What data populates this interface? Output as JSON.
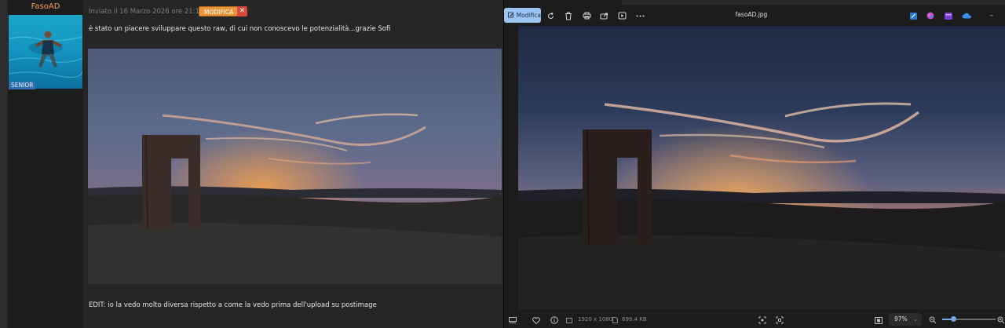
{
  "forum": {
    "username": "FasoAD",
    "rank": "SENIOR",
    "post_meta": "Inviato il 16 Marzo 2026 ore 21:10",
    "edit_label": "MODIFICA",
    "delete_label": "✕",
    "post_text": "è stato un piacere sviluppare questo raw, di cui non conoscevo le potenzialità...grazie Sofi",
    "edit_note": "EDIT: io la vedo molto diversa rispetto a come la vedo prima dell'upload su postimage"
  },
  "viewer": {
    "edit_button_label": "Modifica",
    "file_title": "fasoAD.jpg",
    "toolbar_icons": [
      "rotate-icon",
      "delete-icon",
      "print-icon",
      "share-icon",
      "slideshow-icon",
      "more-icon"
    ],
    "app_icons": [
      "app-blue-icon",
      "app-copilot-icon",
      "app-clipchamp-icon",
      "onedrive-icon"
    ],
    "resolution": "1920 x 1080",
    "file_size": "699.4 KB",
    "zoom_label": "97%",
    "zoom_fraction": 0.2,
    "minimize_label": "–"
  },
  "colors": {
    "accent": "#9cc5f5",
    "username": "#f0a24a",
    "edit_button": "#e8963a",
    "delete_button": "#d94a3d",
    "rank_badge": "#2f6fb0"
  }
}
